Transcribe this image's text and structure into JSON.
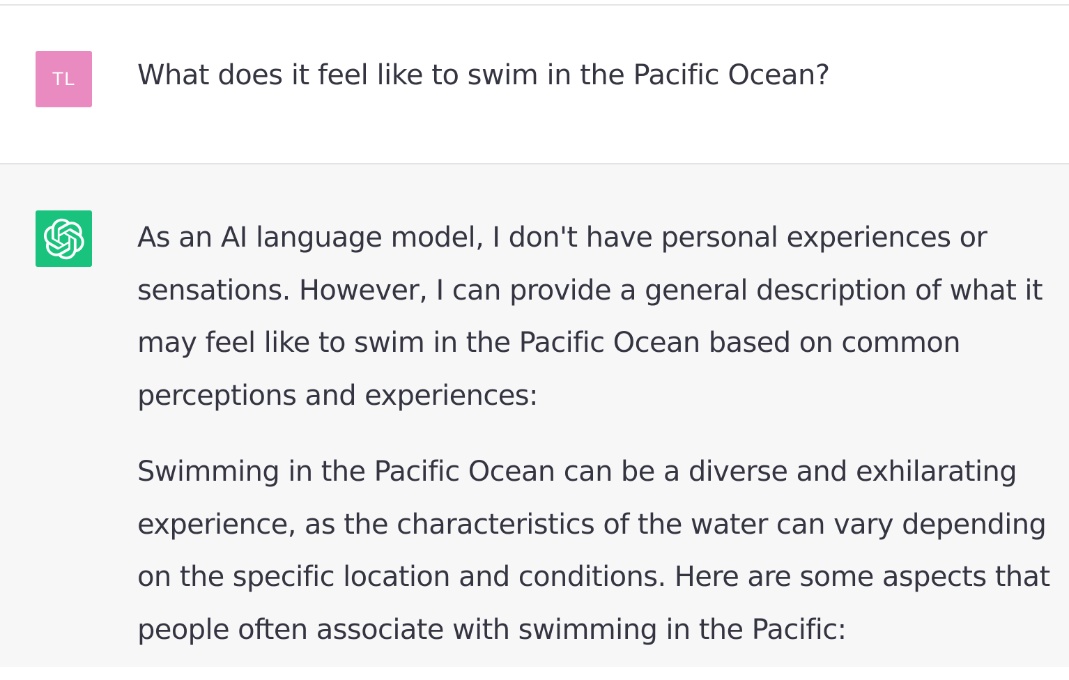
{
  "user_message": {
    "avatar_initials": "TL",
    "avatar_color": "#e98bc0",
    "text": "What does it feel like to swim in the Pacific Ocean?"
  },
  "assistant_message": {
    "avatar_icon": "openai-logo-icon",
    "avatar_color": "#19c37d",
    "paragraphs": [
      "As an AI language model, I don't have personal experiences or sensations. However, I can provide a general description of what it may feel like to swim in the Pacific Ocean based on common perceptions and experiences:",
      "Swimming in the Pacific Ocean can be a diverse and exhilarating experience, as the characteristics of the water can vary depending on the specific location and conditions. Here are some aspects that people often associate with swimming in the Pacific:"
    ]
  }
}
